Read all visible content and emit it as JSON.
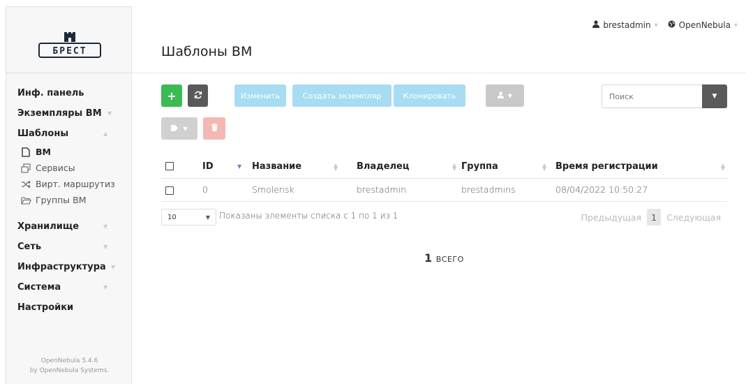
{
  "logo": {
    "text": "БРЕСТ"
  },
  "sidebar": {
    "items": [
      {
        "label": "Инф. панель"
      },
      {
        "label": "Экземпляры ВМ"
      },
      {
        "label": "Шаблоны"
      },
      {
        "label": "Хранилище"
      },
      {
        "label": "Сеть"
      },
      {
        "label": "Инфраструктура"
      },
      {
        "label": "Система"
      },
      {
        "label": "Настройки"
      }
    ],
    "templates_sub": [
      {
        "label": "ВМ",
        "icon": "file-icon"
      },
      {
        "label": "Сервисы",
        "icon": "services-icon"
      },
      {
        "label": "Вирт. маршрутиз",
        "icon": "shuffle-icon"
      },
      {
        "label": "Группы ВМ",
        "icon": "folder-open-icon"
      }
    ],
    "version_line1": "OpenNebula 5.4.6",
    "version_line2": "by OpenNebula Systems."
  },
  "topbar": {
    "user": "brestadmin",
    "zone": "OpenNebula"
  },
  "page": {
    "title": "Шаблоны ВМ"
  },
  "toolbar": {
    "update_label": "Изменить",
    "instantiate_label": "Создать экземпляр",
    "clone_label": "Клонировать",
    "search_placeholder": "Поиск"
  },
  "table": {
    "headers": [
      "ID",
      "Название",
      "Владелец",
      "Группа",
      "Время регистрации"
    ],
    "rows": [
      {
        "id": "0",
        "name": "Smolensk",
        "owner": "brestadmin",
        "group": "brestadmins",
        "time": "08/04/2022 10:50:27"
      }
    ]
  },
  "footer": {
    "page_length": "10",
    "info": "Показаны элементы списка с 1 по 1 из 1",
    "prev": "Предыдущая",
    "page": "1",
    "next": "Следующая"
  },
  "total": {
    "count": "1",
    "label": "ВСЕГО"
  },
  "colors": {
    "add": "#3cba54",
    "dark": "#5a5a5a",
    "disabled_blue": "#a7dcf3",
    "delete": "#f5b7b2",
    "sort_active": "#6a88c6"
  }
}
